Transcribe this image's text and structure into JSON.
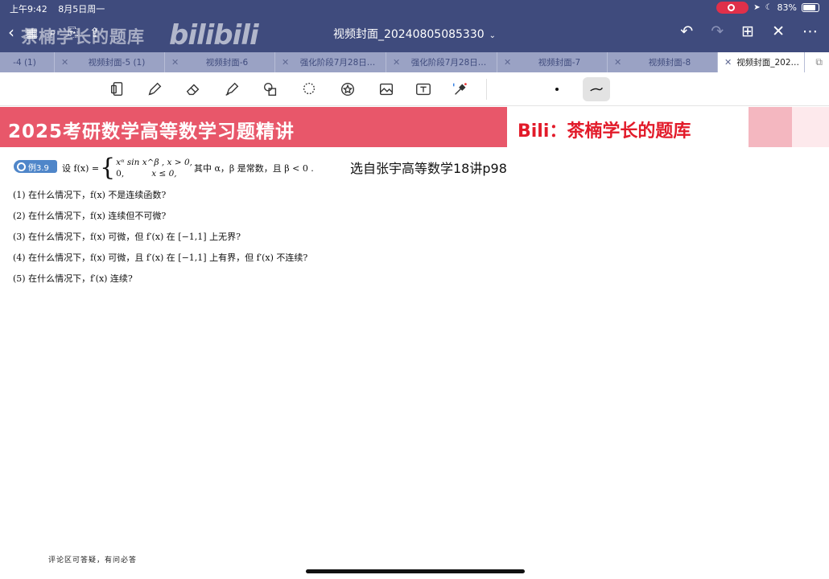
{
  "status_bar": {
    "time": "上午9:42",
    "date": "8月5日周一",
    "battery": "83%"
  },
  "watermark": {
    "channel": "茶楠学长的题库",
    "logo": "bilibili"
  },
  "title_bar": {
    "document_title": "视频封面_20240805085330",
    "caret": "⌄"
  },
  "tabs": [
    {
      "label": "-4 (1)",
      "active": false
    },
    {
      "label": "视频封面-5 (1)",
      "active": false
    },
    {
      "label": "视频封面-6",
      "active": false
    },
    {
      "label": "强化阶段7月28日…",
      "active": false
    },
    {
      "label": "强化阶段7月28日…",
      "active": false
    },
    {
      "label": "视频封面-7",
      "active": false
    },
    {
      "label": "视频封面-8",
      "active": false
    },
    {
      "label": "视频封面_202…",
      "active": true
    }
  ],
  "toolbar": {
    "tools": [
      "page-view-tool",
      "pen-tool",
      "eraser-tool",
      "highlighter-tool",
      "shapes-tool",
      "lasso-tool",
      "sticker-tool",
      "image-tool",
      "text-tool",
      "laser-pointer-tool"
    ],
    "selected": "stroke-style"
  },
  "banner": {
    "title": "2025考研数学高等数学习题精讲",
    "brand": "Bili：茶楠学长的题库"
  },
  "content": {
    "example_label": "例3.9",
    "problem_prefix": "设 f(x) =",
    "case1": "xᵅ sin x^β , x > 0,",
    "case2_left": "0,",
    "case2_right": "x ≤ 0,",
    "problem_suffix": "其中 α，β 是常数，且 β < 0 .",
    "source_note": "选自张宇高等数学18讲p98",
    "questions": [
      "(1) 在什么情况下，f(x) 不是连续函数?",
      "(2) 在什么情况下，f(x) 连续但不可微?",
      "(3) 在什么情况下，f(x) 可微，但 f′(x) 在 [−1,1] 上无界?",
      "(4) 在什么情况下，f(x) 可微，且 f′(x) 在 [−1,1] 上有界，但 f′(x) 不连续?",
      "(5) 在什么情况下，f′(x) 连续?"
    ],
    "comment_note": "评论区可答疑，有问必答"
  },
  "colors": {
    "title_bar": "#3f4b7d",
    "tab_strip": "#9aa2c4",
    "banner_red": "#e8576a",
    "brand_red": "#e21b2a",
    "example_badge": "#4f86c9"
  }
}
